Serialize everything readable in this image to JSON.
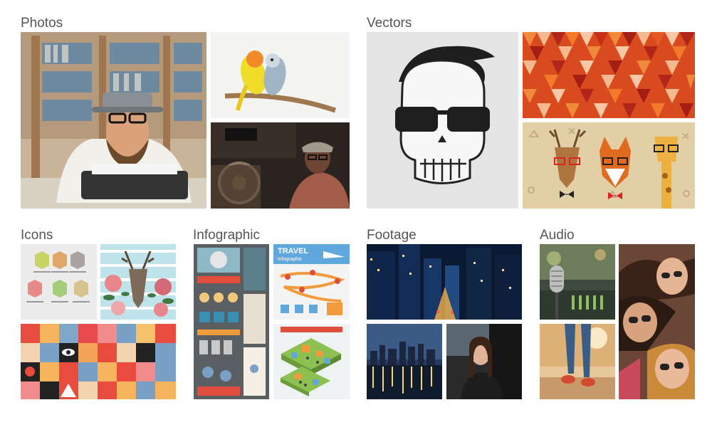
{
  "categories": {
    "photos": {
      "title": "Photos"
    },
    "vectors": {
      "title": "Vectors"
    },
    "icons": {
      "title": "Icons"
    },
    "infographic": {
      "title": "Infographic"
    },
    "footage": {
      "title": "Footage"
    },
    "audio": {
      "title": "Audio"
    }
  },
  "thumbnails": {
    "infographic_top_right": {
      "label": "TRAVEL",
      "sublabel": "infographic"
    }
  },
  "colors": {
    "title_text": "#555555",
    "background": "#ffffff"
  }
}
